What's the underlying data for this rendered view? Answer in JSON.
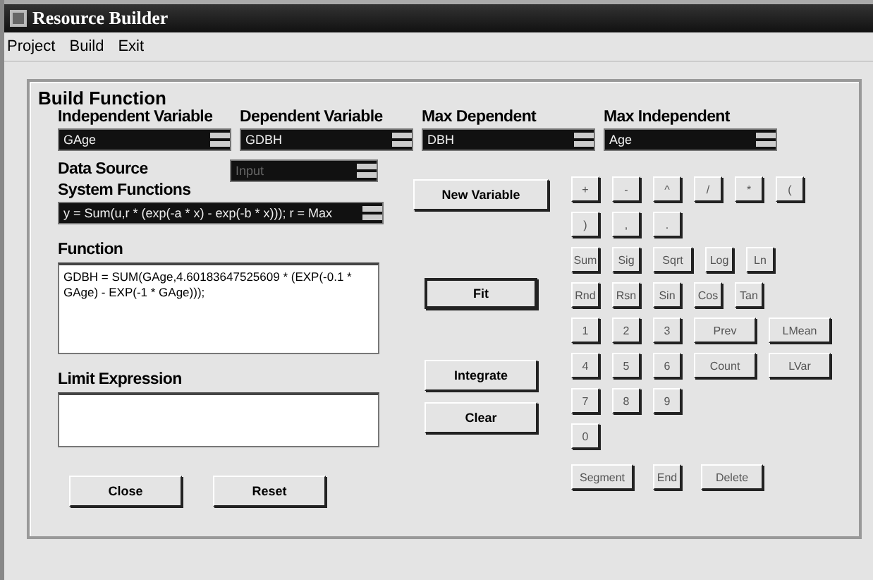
{
  "window": {
    "title": "Resource Builder"
  },
  "menu": [
    "Project",
    "Build",
    "Exit"
  ],
  "group": {
    "title": "Build Function"
  },
  "selectors": [
    {
      "label": "Independent Variable",
      "value": "GAge"
    },
    {
      "label": "Dependent Variable",
      "value": "GDBH"
    },
    {
      "label": "Max Dependent",
      "value": "DBH"
    },
    {
      "label": "Max Independent",
      "value": "Age"
    }
  ],
  "data_source": {
    "label": "Data Source",
    "value": "Input",
    "disabled": true
  },
  "system_functions": {
    "label": "System Functions",
    "value": "y = Sum(u,r * (exp(-a * x) - exp(-b * x))); r = Max"
  },
  "function": {
    "label": "Function",
    "value": "GDBH = SUM(GAge,4.60183647525609 * (EXP(-0.1 * GAge) - EXP(-1 * GAge)));"
  },
  "limit_expression": {
    "label": "Limit Expression"
  },
  "new_variable_button": "New Variable",
  "fit_button": "Fit",
  "side_buttons": [
    "Integrate",
    "Clear"
  ],
  "bottom_buttons": [
    "Close",
    "Reset"
  ],
  "keypad_rows": [
    [
      "+",
      "-",
      "^",
      "/",
      "*",
      "("
    ],
    [
      ")",
      ",",
      "."
    ],
    [
      "Sum",
      "Sig",
      "Sqrt",
      "Log",
      "Ln"
    ],
    [
      "Rnd",
      "Rsn",
      "Sin",
      "Cos",
      "Tan"
    ],
    [
      "1",
      "2",
      "3",
      "Prev",
      "LMean"
    ],
    [
      "4",
      "5",
      "6",
      "Count",
      "LVar"
    ],
    [
      "7",
      "8",
      "9"
    ],
    [
      "0"
    ],
    [
      "Segment",
      "End",
      "Delete"
    ]
  ]
}
